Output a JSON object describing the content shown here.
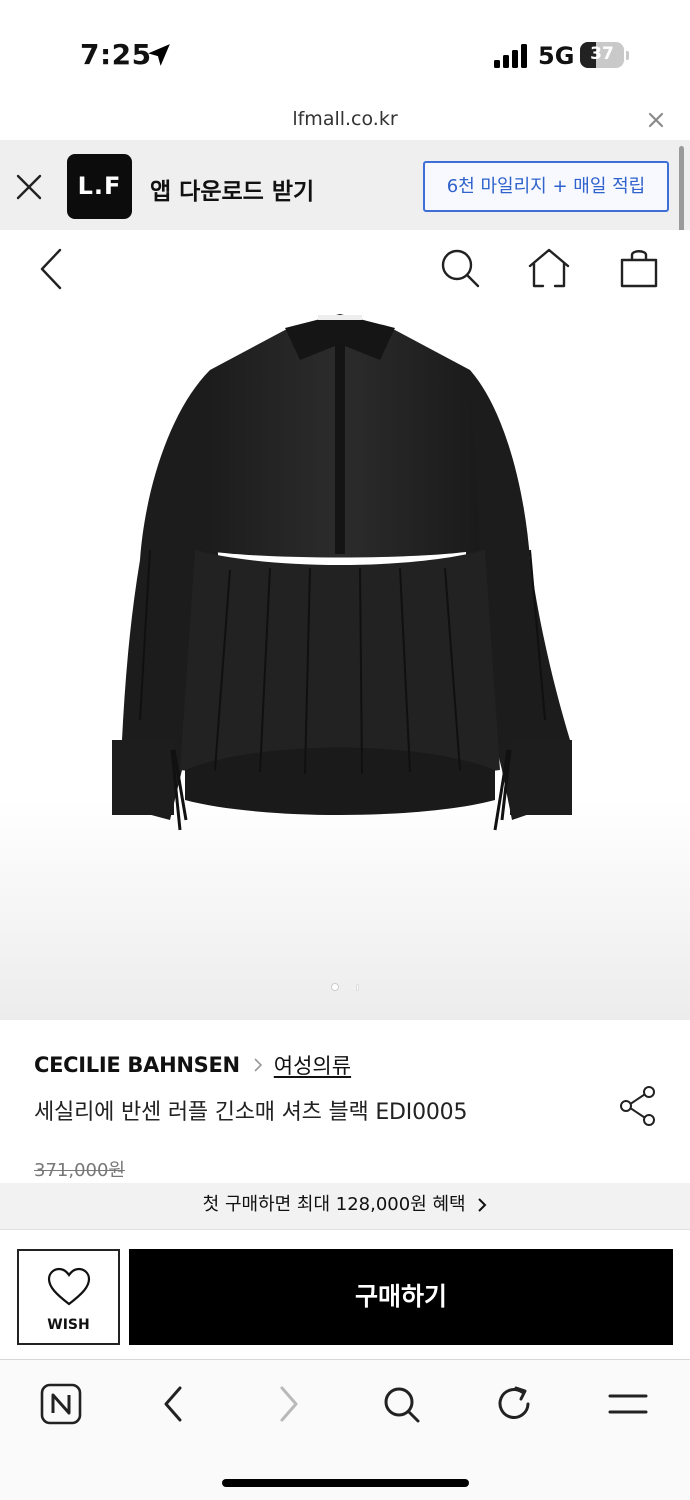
{
  "status_bar": {
    "time": "7:25",
    "network": "5G",
    "battery_level": "37",
    "battery_fraction": 0.37,
    "icons": [
      "location-arrow-icon",
      "cellular-signal-icon",
      "battery-icon"
    ]
  },
  "browser": {
    "url": "lfmall.co.kr",
    "close_icon": "close-icon"
  },
  "app_banner": {
    "logo_text": "L.F",
    "title": "앱 다운로드 받기",
    "cta_label": "6천 마일리지 + 매일 적립",
    "accent_color": "#2f62cc",
    "background": "#efefef"
  },
  "top_nav": {
    "icons": [
      "back-arrow-icon",
      "search-icon",
      "home-icon",
      "shopping-bag-icon"
    ]
  },
  "product": {
    "brand": "CECILIE BAHNSEN",
    "category": "여성의류",
    "title": "세실리에 반센 러플 긴소매 셔츠 블랙 EDI0005",
    "original_price": "371,000원",
    "image_alt": "black ruffle long sleeve shirt",
    "image_count": 2,
    "active_image_index": 0
  },
  "promo": {
    "text": "첫 구매하면 최대 128,000원 혜택"
  },
  "actions": {
    "wish_label": "WISH",
    "buy_label": "구매하기",
    "buy_color": "#000000"
  },
  "toolbar": {
    "icons": [
      "naver-n-icon",
      "back-icon",
      "forward-icon",
      "search-icon",
      "refresh-icon",
      "menu-icon"
    ]
  }
}
